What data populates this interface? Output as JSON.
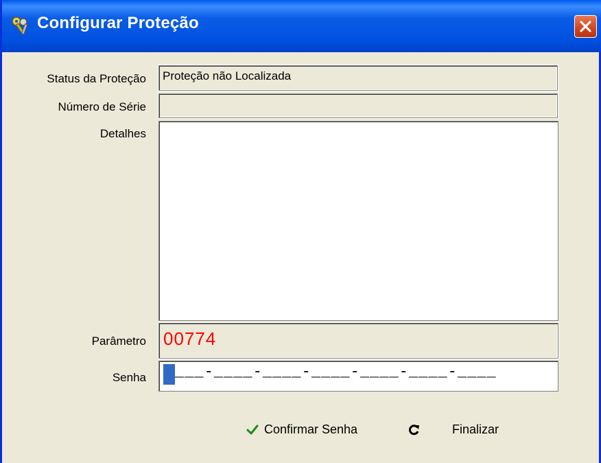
{
  "window": {
    "title": "Configurar Proteção",
    "icon": "keys-icon",
    "close_icon": "close-icon",
    "colors": {
      "titlebar": "#0a5ce6",
      "client": "#ece9d8",
      "close": "#d0451c",
      "parametro": "#ff0000",
      "caret": "#3169c6"
    }
  },
  "form": {
    "status_label": "Status da Proteção",
    "status_value": "Proteção não Localizada",
    "serie_label": "Número de Série",
    "serie_value": "",
    "detalhes_label": "Detalhes",
    "detalhes_value": "",
    "parametro_label": "Parâmetro",
    "parametro_value": "00774",
    "senha_label": "Senha",
    "senha_mask": "___-____-____-____-____-____-____"
  },
  "buttons": {
    "confirmar_label": "Confirmar Senha",
    "confirmar_icon": "checkmark-icon",
    "finalizar_label": "Finalizar",
    "finalizar_icon": "refresh-icon"
  }
}
